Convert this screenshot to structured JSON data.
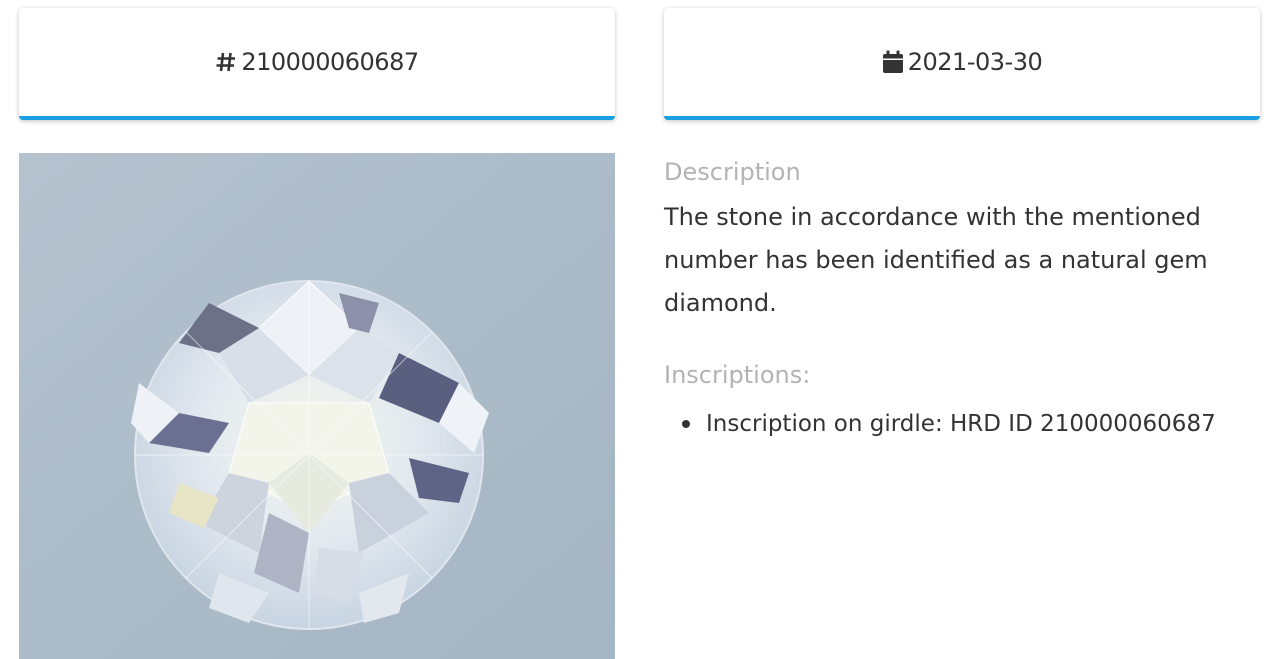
{
  "header": {
    "certificate_card": {
      "icon": "hash-icon",
      "number": "210000060687"
    },
    "date_card": {
      "icon": "calendar-icon",
      "date": "2021-03-30"
    },
    "accent_color": "#1a9fe0"
  },
  "photo": {
    "subject": "diamond-photo",
    "background_color": "#aabac8"
  },
  "details": {
    "description_label": "Description",
    "description_text": "The stone in accordance with the mentioned number has been identified as a natural gem diamond.",
    "inscriptions_label": "Inscriptions:",
    "inscriptions": [
      "Inscription on girdle: HRD ID 210000060687"
    ]
  }
}
